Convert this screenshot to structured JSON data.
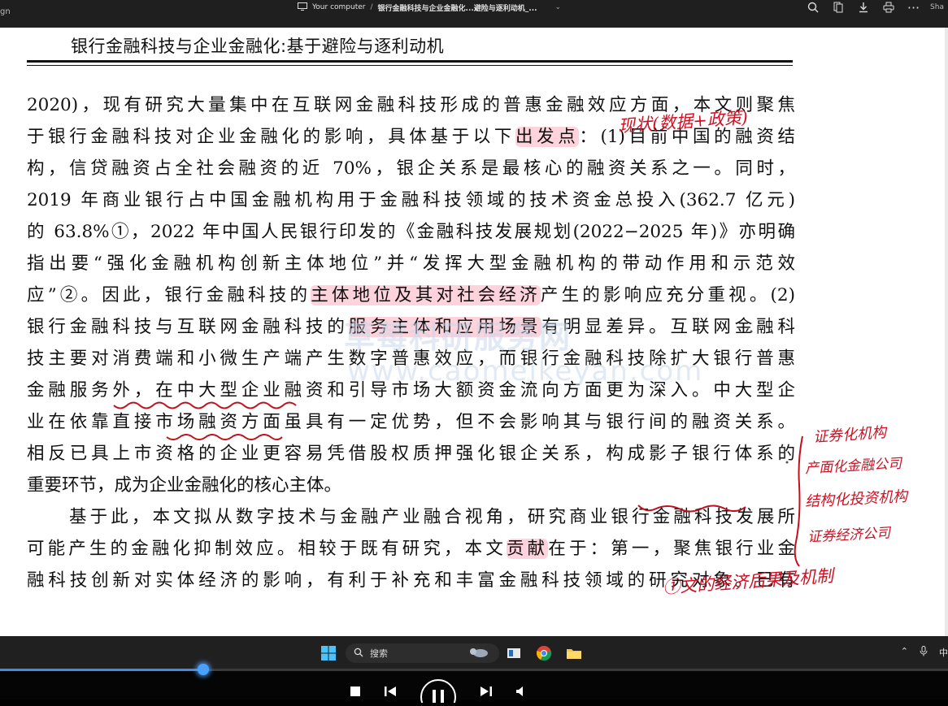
{
  "browser": {
    "edge_left_text": "gn",
    "location": "Your computer",
    "separator": "/",
    "file_name": "银行金融科技与企业金融化...避险与逐利动机_...",
    "share_label": "Sha"
  },
  "document": {
    "header": "银行金融科技与企业金融化:基于避险与逐利动机",
    "lines": [
      [
        "2020)，现有研究大量集中在互联网金融科技形成的普惠金融效应方面，本文则聚焦"
      ],
      [
        "于银行金融科技对企业金融化的影响，具体基于以下",
        {
          "hl": "出发点"
        },
        "：(1)目前中国的融资结"
      ],
      [
        "构，信贷融资占全社会融资的近 70%，银企关系是最核心的融资关系之一。同时，"
      ],
      [
        "2019 年商业银行占中国金融机构用于金融科技领域的技术资金总投入(362.7 亿元)"
      ],
      [
        "的 63.8%①，2022 年中国人民银行印发的《金融科技发展规划(2022−2025 年)》亦明确"
      ],
      [
        "指出要“强化金融机构创新主体地位”并“发挥大型金融机构的带动作用和示范效"
      ],
      [
        "应”②。因此，银行金融科技的",
        {
          "hl": "主体地位及其对社会经济"
        },
        "产生的影响应充分重视。(2)"
      ],
      [
        "银行金融科技与互联网金融科技的",
        {
          "hl": "服务主体和应用场景"
        },
        "有明显差异。互联网金融科"
      ],
      [
        "技主要对消费端和小微生产端产生数字普惠效应，而银行金融科技除扩大银行普惠"
      ],
      [
        "金融服务外，在中大型企业融资和引导市场大额资金流向方面更为深入。中大型企"
      ],
      [
        "业在依靠直接市场融资方面虽具有一定优势，但不会影响其与银行间的融资关系。"
      ],
      [
        "相反已具上市资格的企业更容易凭借股权质押强化银企关系，构成影子银行体系的"
      ],
      [
        "重要环节，成为企业金融化的核心主体。"
      ],
      [
        "基于此，本文拟从数字技术与金融产业融合视角，研究商业银行金融科技发展所"
      ],
      [
        "可能产生的金融化抑制效应。相较于既有研究，本文",
        {
          "hl": "贡献"
        },
        "在于：第一，聚焦银行业金"
      ],
      [
        "融科技创新对实体经济的影响，有利于补充和丰富金融科技领域的研究对象。已有"
      ]
    ],
    "watermark": [
      "草莓科研服务网",
      "www.caomeikeyan.com"
    ]
  },
  "annotations": {
    "top_note": "现状(数据+政策)",
    "side_notes": [
      "证券化机构",
      "产面化金融公司",
      "结构化投资机构",
      "证券经济公司"
    ],
    "bottom_note": "①文的经济后果及机制"
  },
  "taskbar": {
    "search_label": "搜索",
    "tray_text": "中"
  },
  "player": {
    "progress_fraction": 0.214
  }
}
